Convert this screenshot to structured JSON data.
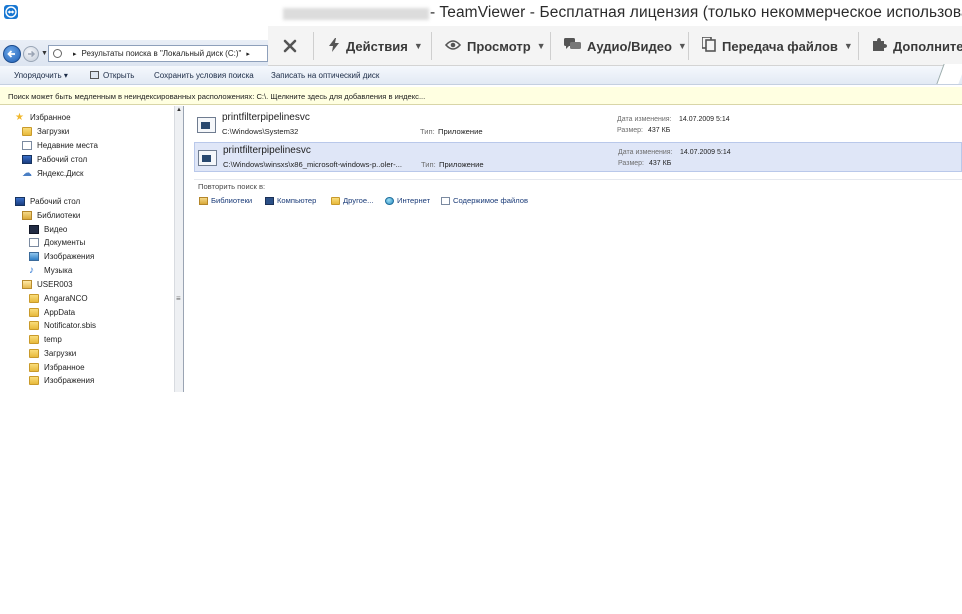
{
  "window": {
    "title": "- TeamViewer - Бесплатная лицензия (только некоммерческое использован"
  },
  "teamviewer_toolbar": {
    "actions": "Действия",
    "view": "Просмотр",
    "audio_video": "Аудио/Видео",
    "file_transfer": "Передача файлов",
    "more": "Дополнител"
  },
  "explorer": {
    "address": {
      "breadcrumb": "Результаты поиска в \"Локальный диск (C:)\""
    },
    "commands": {
      "organize": "Упорядочить ▾",
      "open": "Открыть",
      "save_search": "Сохранить условия поиска",
      "burn": "Записать на оптический диск"
    },
    "infobar": "Поиск может быть медленным в неиндексированных расположениях: C:\\. Щелкните здесь для добавления в индекс...",
    "nav": [
      {
        "label": "Избранное",
        "icon": "star-icon"
      },
      {
        "label": "Загрузки",
        "icon": "downloads-folder-icon"
      },
      {
        "label": "Недавние места",
        "icon": "recent-places-icon"
      },
      {
        "label": "Рабочий стол",
        "icon": "desktop-icon"
      },
      {
        "label": "Яндекс.Диск",
        "icon": "cloud-icon"
      },
      {
        "label": "Рабочий стол",
        "icon": "desktop-icon"
      },
      {
        "label": "Библиотеки",
        "icon": "libraries-icon"
      },
      {
        "label": "Видео",
        "icon": "video-library-icon"
      },
      {
        "label": "Документы",
        "icon": "documents-library-icon"
      },
      {
        "label": "Изображения",
        "icon": "pictures-library-icon"
      },
      {
        "label": "Музыка",
        "icon": "music-library-icon"
      },
      {
        "label": "USER003",
        "icon": "user-folder-icon"
      },
      {
        "label": "AngaraNCO",
        "icon": "folder-icon"
      },
      {
        "label": "AppData",
        "icon": "folder-icon"
      },
      {
        "label": "Notificator.sbis",
        "icon": "folder-icon"
      },
      {
        "label": "temp",
        "icon": "folder-icon"
      },
      {
        "label": "Загрузки",
        "icon": "downloads-folder-icon"
      },
      {
        "label": "Избранное",
        "icon": "favorites-folder-icon"
      },
      {
        "label": "Изображения",
        "icon": "pictures-folder-icon"
      }
    ],
    "results": [
      {
        "name": "printfilterpipelinesvc",
        "path": "C:\\Windows\\System32",
        "type_label": "Тип:",
        "type_value": "Приложение",
        "date_label": "Дата изменения:",
        "date_value": "14.07.2009 5:14",
        "size_label": "Размер:",
        "size_value": "437 КБ",
        "selected": false
      },
      {
        "name": "printfilterpipelinesvc",
        "path": "C:\\Windows\\winsxs\\x86_microsoft-windows-p..oler-...",
        "type_label": "Тип:",
        "type_value": "Приложение",
        "date_label": "Дата изменения:",
        "date_value": "14.07.2009 5:14",
        "size_label": "Размер:",
        "size_value": "437 КБ",
        "selected": true
      }
    ],
    "repeat_search": {
      "label": "Повторить поиск в:",
      "links": {
        "libraries": "Библиотеки",
        "computer": "Компьютер",
        "other": "Другое...",
        "internet": "Интернет",
        "file_contents": "Содержимое файлов"
      }
    }
  },
  "colors": {
    "teamviewer_blue": "#1877d2",
    "selection": "#dfe6f7",
    "infobar": "#ffffe1"
  }
}
